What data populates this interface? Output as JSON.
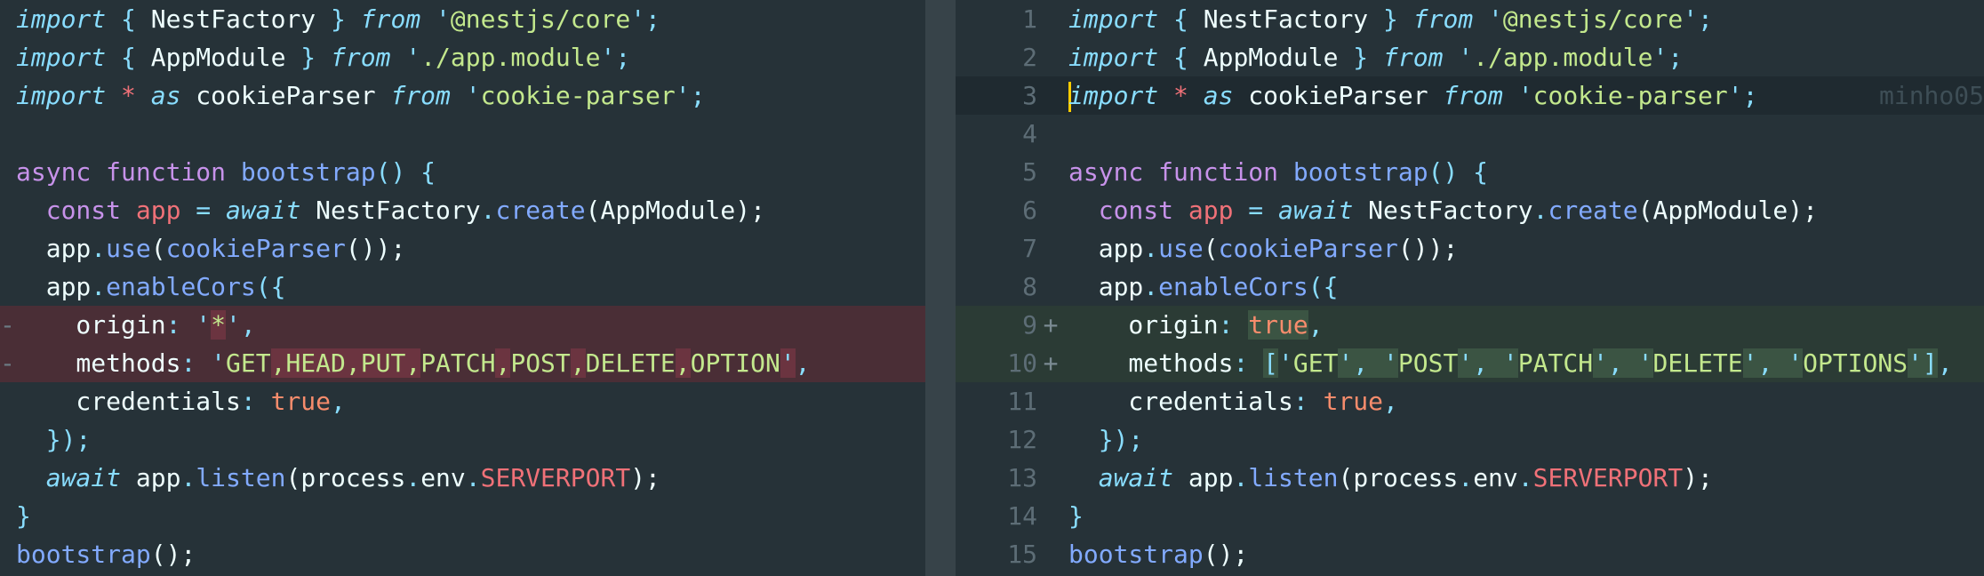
{
  "diff": {
    "left": {
      "lines": [
        {
          "marker": "",
          "tokens": [
            {
              "t": "import",
              "c": "kwi"
            },
            {
              "t": " { ",
              "c": "pun"
            },
            {
              "t": "NestFactory",
              "c": "txt"
            },
            {
              "t": " } ",
              "c": "pun"
            },
            {
              "t": "from",
              "c": "kwi"
            },
            {
              "t": " '",
              "c": "pun"
            },
            {
              "t": "@nestjs/core",
              "c": "str"
            },
            {
              "t": "';",
              "c": "pun"
            }
          ]
        },
        {
          "marker": "",
          "tokens": [
            {
              "t": "import",
              "c": "kwi"
            },
            {
              "t": " { ",
              "c": "pun"
            },
            {
              "t": "AppModule",
              "c": "txt"
            },
            {
              "t": " } ",
              "c": "pun"
            },
            {
              "t": "from",
              "c": "kwi"
            },
            {
              "t": " '",
              "c": "pun"
            },
            {
              "t": "./app.module",
              "c": "str"
            },
            {
              "t": "';",
              "c": "pun"
            }
          ]
        },
        {
          "marker": "",
          "tokens": [
            {
              "t": "import",
              "c": "kwi"
            },
            {
              "t": " ",
              "c": "txt"
            },
            {
              "t": "*",
              "c": "var"
            },
            {
              "t": " ",
              "c": "txt"
            },
            {
              "t": "as",
              "c": "kwi"
            },
            {
              "t": " cookieParser ",
              "c": "txt"
            },
            {
              "t": "from",
              "c": "kwi"
            },
            {
              "t": " '",
              "c": "pun"
            },
            {
              "t": "cookie-parser",
              "c": "str"
            },
            {
              "t": "';",
              "c": "pun"
            }
          ]
        },
        {
          "marker": "",
          "tokens": []
        },
        {
          "marker": "",
          "tokens": [
            {
              "t": "async",
              "c": "kw"
            },
            {
              "t": " ",
              "c": "txt"
            },
            {
              "t": "function",
              "c": "kw"
            },
            {
              "t": " ",
              "c": "txt"
            },
            {
              "t": "bootstrap",
              "c": "fn"
            },
            {
              "t": "() {",
              "c": "pun"
            }
          ]
        },
        {
          "marker": "",
          "tokens": [
            {
              "t": "  ",
              "c": "txt"
            },
            {
              "t": "const",
              "c": "kw"
            },
            {
              "t": " ",
              "c": "txt"
            },
            {
              "t": "app",
              "c": "var"
            },
            {
              "t": " = ",
              "c": "pun"
            },
            {
              "t": "await",
              "c": "kwi"
            },
            {
              "t": " NestFactory",
              "c": "txt"
            },
            {
              "t": ".",
              "c": "pun"
            },
            {
              "t": "create",
              "c": "fn"
            },
            {
              "t": "(AppModule);",
              "c": "txt"
            }
          ]
        },
        {
          "marker": "",
          "tokens": [
            {
              "t": "  app",
              "c": "txt"
            },
            {
              "t": ".",
              "c": "pun"
            },
            {
              "t": "use",
              "c": "fn"
            },
            {
              "t": "(",
              "c": "txt"
            },
            {
              "t": "cookieParser",
              "c": "fn"
            },
            {
              "t": "());",
              "c": "txt"
            }
          ]
        },
        {
          "marker": "",
          "tokens": [
            {
              "t": "  app",
              "c": "txt"
            },
            {
              "t": ".",
              "c": "pun"
            },
            {
              "t": "enableCors",
              "c": "fn"
            },
            {
              "t": "({",
              "c": "pun"
            }
          ]
        },
        {
          "marker": "-",
          "kind": "del",
          "tokens": [
            {
              "t": "    origin",
              "c": "txt"
            },
            {
              "t": ": '",
              "c": "pun"
            },
            {
              "t": "*",
              "c": "str",
              "hl": true
            },
            {
              "t": "',",
              "c": "pun"
            }
          ]
        },
        {
          "marker": "-",
          "kind": "del",
          "tokens": [
            {
              "t": "    methods",
              "c": "txt"
            },
            {
              "t": ": '",
              "c": "pun"
            },
            {
              "t": "GET",
              "c": "str"
            },
            {
              "t": ",",
              "c": "str",
              "hl": true
            },
            {
              "t": "HEAD",
              "c": "str",
              "hl": true
            },
            {
              "t": ",",
              "c": "str",
              "hl": true
            },
            {
              "t": "PUT",
              "c": "str",
              "hl": true
            },
            {
              "t": ",",
              "c": "str",
              "hl": true
            },
            {
              "t": "PATCH",
              "c": "str"
            },
            {
              "t": ",",
              "c": "str",
              "hl": true
            },
            {
              "t": "POST",
              "c": "str"
            },
            {
              "t": ",",
              "c": "str",
              "hl": true
            },
            {
              "t": "DELETE",
              "c": "str"
            },
            {
              "t": ",",
              "c": "str",
              "hl": true
            },
            {
              "t": "OPTION",
              "c": "str"
            },
            {
              "t": "'",
              "c": "pun",
              "hl": true
            },
            {
              "t": ",",
              "c": "pun"
            }
          ]
        },
        {
          "marker": "",
          "tokens": [
            {
              "t": "    credentials",
              "c": "txt"
            },
            {
              "t": ": ",
              "c": "pun"
            },
            {
              "t": "true",
              "c": "cons"
            },
            {
              "t": ",",
              "c": "pun"
            }
          ]
        },
        {
          "marker": "",
          "tokens": [
            {
              "t": "  });",
              "c": "pun"
            }
          ]
        },
        {
          "marker": "",
          "tokens": [
            {
              "t": "  ",
              "c": "txt"
            },
            {
              "t": "await",
              "c": "kwi"
            },
            {
              "t": " app",
              "c": "txt"
            },
            {
              "t": ".",
              "c": "pun"
            },
            {
              "t": "listen",
              "c": "fn"
            },
            {
              "t": "(process",
              "c": "txt"
            },
            {
              "t": ".",
              "c": "pun"
            },
            {
              "t": "env",
              "c": "txt"
            },
            {
              "t": ".",
              "c": "pun"
            },
            {
              "t": "SERVERPORT",
              "c": "var"
            },
            {
              "t": ");",
              "c": "txt"
            }
          ]
        },
        {
          "marker": "",
          "tokens": [
            {
              "t": "}",
              "c": "pun"
            }
          ]
        },
        {
          "marker": "",
          "tokens": [
            {
              "t": "bootstrap",
              "c": "fn"
            },
            {
              "t": "();",
              "c": "txt"
            }
          ]
        }
      ]
    },
    "right": {
      "blame": "minho05",
      "lines": [
        {
          "num": "1",
          "tokens": [
            {
              "t": "import",
              "c": "kwi"
            },
            {
              "t": " { ",
              "c": "pun"
            },
            {
              "t": "NestFactory",
              "c": "txt"
            },
            {
              "t": " } ",
              "c": "pun"
            },
            {
              "t": "from",
              "c": "kwi"
            },
            {
              "t": " '",
              "c": "pun"
            },
            {
              "t": "@nestjs/core",
              "c": "str"
            },
            {
              "t": "';",
              "c": "pun"
            }
          ]
        },
        {
          "num": "2",
          "tokens": [
            {
              "t": "import",
              "c": "kwi"
            },
            {
              "t": " { ",
              "c": "pun"
            },
            {
              "t": "AppModule",
              "c": "txt"
            },
            {
              "t": " } ",
              "c": "pun"
            },
            {
              "t": "from",
              "c": "kwi"
            },
            {
              "t": " '",
              "c": "pun"
            },
            {
              "t": "./app.module",
              "c": "str"
            },
            {
              "t": "';",
              "c": "pun"
            }
          ]
        },
        {
          "num": "3",
          "kind": "cur",
          "tokens": [
            {
              "t": "import",
              "c": "kwi"
            },
            {
              "t": " ",
              "c": "txt"
            },
            {
              "t": "*",
              "c": "var"
            },
            {
              "t": " ",
              "c": "txt"
            },
            {
              "t": "as",
              "c": "kwi"
            },
            {
              "t": " cookieParser ",
              "c": "txt"
            },
            {
              "t": "from",
              "c": "kwi"
            },
            {
              "t": " '",
              "c": "pun"
            },
            {
              "t": "cookie-parser",
              "c": "str"
            },
            {
              "t": "';",
              "c": "pun"
            }
          ]
        },
        {
          "num": "4",
          "tokens": []
        },
        {
          "num": "5",
          "tokens": [
            {
              "t": "async",
              "c": "kw"
            },
            {
              "t": " ",
              "c": "txt"
            },
            {
              "t": "function",
              "c": "kw"
            },
            {
              "t": " ",
              "c": "txt"
            },
            {
              "t": "bootstrap",
              "c": "fn"
            },
            {
              "t": "() {",
              "c": "pun"
            }
          ]
        },
        {
          "num": "6",
          "tokens": [
            {
              "t": "  ",
              "c": "txt"
            },
            {
              "t": "const",
              "c": "kw"
            },
            {
              "t": " ",
              "c": "txt"
            },
            {
              "t": "app",
              "c": "var"
            },
            {
              "t": " = ",
              "c": "pun"
            },
            {
              "t": "await",
              "c": "kwi"
            },
            {
              "t": " NestFactory",
              "c": "txt"
            },
            {
              "t": ".",
              "c": "pun"
            },
            {
              "t": "create",
              "c": "fn"
            },
            {
              "t": "(AppModule);",
              "c": "txt"
            }
          ]
        },
        {
          "num": "7",
          "tokens": [
            {
              "t": "  app",
              "c": "txt"
            },
            {
              "t": ".",
              "c": "pun"
            },
            {
              "t": "use",
              "c": "fn"
            },
            {
              "t": "(",
              "c": "txt"
            },
            {
              "t": "cookieParser",
              "c": "fn"
            },
            {
              "t": "());",
              "c": "txt"
            }
          ]
        },
        {
          "num": "8",
          "tokens": [
            {
              "t": "  app",
              "c": "txt"
            },
            {
              "t": ".",
              "c": "pun"
            },
            {
              "t": "enableCors",
              "c": "fn"
            },
            {
              "t": "({",
              "c": "pun"
            }
          ]
        },
        {
          "num": "9",
          "kind": "add",
          "plus": "+",
          "tokens": [
            {
              "t": "    origin",
              "c": "txt"
            },
            {
              "t": ": ",
              "c": "pun"
            },
            {
              "t": "true",
              "c": "cons",
              "hl": true
            },
            {
              "t": ",",
              "c": "pun"
            }
          ]
        },
        {
          "num": "10",
          "kind": "add",
          "plus": "+",
          "tokens": [
            {
              "t": "    methods",
              "c": "txt"
            },
            {
              "t": ": ",
              "c": "pun"
            },
            {
              "t": "[",
              "c": "pun",
              "hl": true
            },
            {
              "t": "'",
              "c": "pun"
            },
            {
              "t": "GET",
              "c": "str"
            },
            {
              "t": "', '",
              "c": "pun",
              "hl": true
            },
            {
              "t": "POST",
              "c": "str"
            },
            {
              "t": "', '",
              "c": "pun",
              "hl": true
            },
            {
              "t": "PATCH",
              "c": "str"
            },
            {
              "t": "', '",
              "c": "pun",
              "hl": true
            },
            {
              "t": "DELETE",
              "c": "str"
            },
            {
              "t": "', '",
              "c": "pun",
              "hl": true
            },
            {
              "t": "OPTIONS",
              "c": "str"
            },
            {
              "t": "']",
              "c": "pun",
              "hl": true
            },
            {
              "t": ",",
              "c": "pun"
            }
          ]
        },
        {
          "num": "11",
          "tokens": [
            {
              "t": "    credentials",
              "c": "txt"
            },
            {
              "t": ": ",
              "c": "pun"
            },
            {
              "t": "true",
              "c": "cons"
            },
            {
              "t": ",",
              "c": "pun"
            }
          ]
        },
        {
          "num": "12",
          "tokens": [
            {
              "t": "  });",
              "c": "pun"
            }
          ]
        },
        {
          "num": "13",
          "tokens": [
            {
              "t": "  ",
              "c": "txt"
            },
            {
              "t": "await",
              "c": "kwi"
            },
            {
              "t": " app",
              "c": "txt"
            },
            {
              "t": ".",
              "c": "pun"
            },
            {
              "t": "listen",
              "c": "fn"
            },
            {
              "t": "(process",
              "c": "txt"
            },
            {
              "t": ".",
              "c": "pun"
            },
            {
              "t": "env",
              "c": "txt"
            },
            {
              "t": ".",
              "c": "pun"
            },
            {
              "t": "SERVERPORT",
              "c": "var"
            },
            {
              "t": ");",
              "c": "txt"
            }
          ]
        },
        {
          "num": "14",
          "tokens": [
            {
              "t": "}",
              "c": "pun"
            }
          ]
        },
        {
          "num": "15",
          "tokens": [
            {
              "t": "bootstrap",
              "c": "fn"
            },
            {
              "t": "();",
              "c": "txt"
            }
          ]
        }
      ]
    }
  }
}
